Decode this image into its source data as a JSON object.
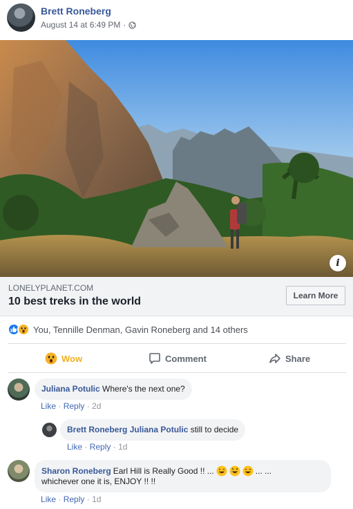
{
  "post": {
    "author": "Brett Roneberg",
    "timestamp": "August 14 at 6:49 PM",
    "separator": "·",
    "privacy_icon": "globe-icon"
  },
  "link": {
    "domain": "LONELYPLANET.COM",
    "title": "10 best treks in the world",
    "cta_label": "Learn More",
    "info_label": "i"
  },
  "reactions": {
    "icons": [
      "like-icon",
      "wow-icon"
    ],
    "summary": "You, Tennille Denman, Gavin Roneberg and 14 others"
  },
  "actions": {
    "wow_label": "Wow",
    "comment_label": "Comment",
    "share_label": "Share"
  },
  "comments": [
    {
      "name": "Juliana Potulic",
      "text": "Where's the next one?",
      "like": "Like",
      "reply": "Reply",
      "sep": "·",
      "age": "2d"
    },
    {
      "name": "Brett Roneberg",
      "mention": "Juliana Potulic",
      "text": "still to decide",
      "like": "Like",
      "reply": "Reply",
      "sep": "·",
      "age": "1d"
    },
    {
      "name": "Sharon Roneberg",
      "text_line1": "Earl Hill is Really Good !! ...",
      "text_line1_end": "... ...",
      "text_line2": "whichever one it is, ENJOY !! !!",
      "emojis": [
        "grin-emoji",
        "rofl-emoji",
        "grin-emoji"
      ],
      "like": "Like",
      "reply": "Reply",
      "sep": "·",
      "age": "1d"
    }
  ],
  "colors": {
    "name_link": "#365899",
    "wow": "#f0b11d",
    "like_blue": "#1877f2"
  }
}
